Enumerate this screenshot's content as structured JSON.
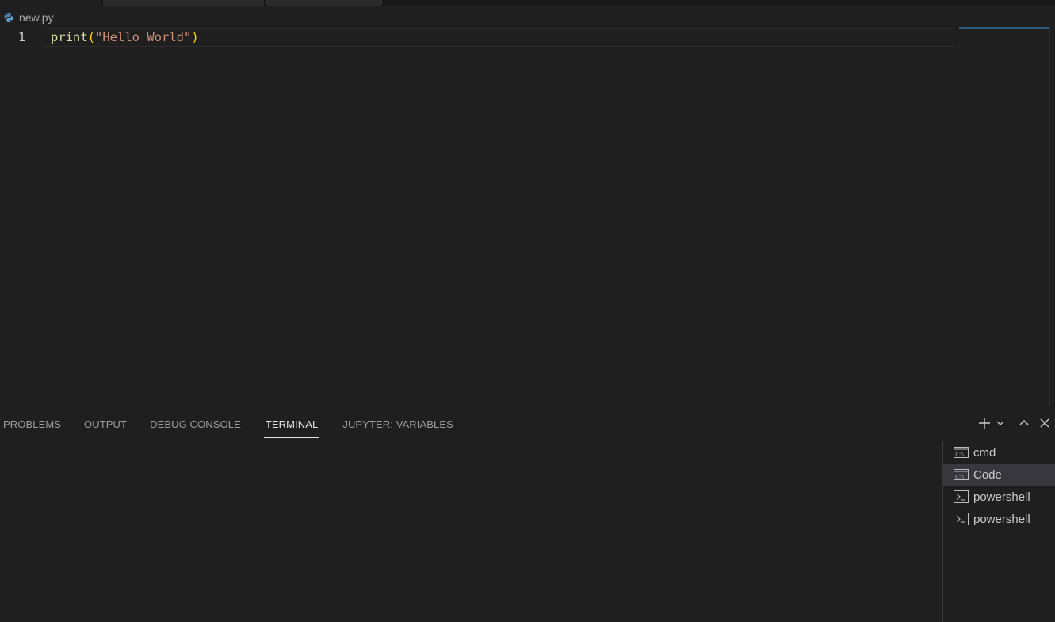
{
  "editor": {
    "file_name": "new.py",
    "file_icon": "python-icon",
    "line_number": "1",
    "code": {
      "fn": "print",
      "open_paren": "(",
      "string": "\"Hello World\"",
      "close_paren": ")"
    }
  },
  "panel": {
    "tabs": [
      {
        "label": "PROBLEMS"
      },
      {
        "label": "OUTPUT"
      },
      {
        "label": "DEBUG CONSOLE"
      },
      {
        "label": "TERMINAL",
        "active": true
      },
      {
        "label": "JUPYTER: VARIABLES"
      }
    ],
    "actions": [
      "plus-icon",
      "chevron-down-icon",
      "chevron-up-icon",
      "close-icon"
    ],
    "terminals": [
      {
        "label": "cmd",
        "icon": "cmd-terminal-icon"
      },
      {
        "label": "Code",
        "icon": "cmd-terminal-icon",
        "selected": true
      },
      {
        "label": "powershell",
        "icon": "powershell-terminal-icon"
      },
      {
        "label": "powershell",
        "icon": "powershell-terminal-icon"
      }
    ]
  },
  "colors": {
    "background": "#1f1f1f",
    "function": "#dcdcaa",
    "string": "#ce9178",
    "bracket": "#ffd700",
    "selected_item": "#37373d"
  }
}
